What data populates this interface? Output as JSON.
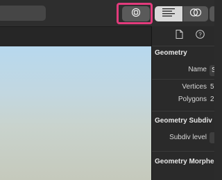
{
  "toolbar": {
    "search_placeholder": "",
    "buttons": {
      "focus": "focus-icon",
      "align": "text-align-icon",
      "rings": "rings-icon"
    }
  },
  "inspector": {
    "tabs": [
      "file-icon",
      "help-icon"
    ],
    "geometry": {
      "title": "Geometry",
      "name_label": "Name",
      "name_value": "S",
      "vertices_label": "Vertices",
      "vertices_value": "5",
      "polygons_label": "Polygons",
      "polygons_value": "2"
    },
    "subdivision": {
      "title": "Geometry Subdiv",
      "level_label": "Subdiv level"
    },
    "morpher": {
      "title": "Geometry Morphe"
    }
  },
  "colors": {
    "highlight": "#e23b7c",
    "panel": "#2a2a2a"
  }
}
